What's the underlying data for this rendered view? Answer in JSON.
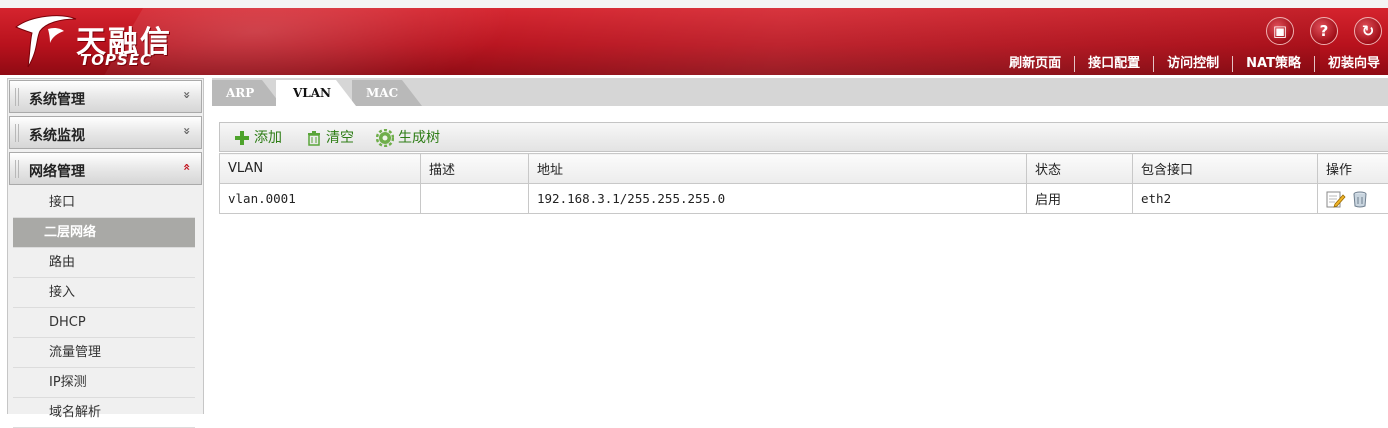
{
  "brand": {
    "name_cn": "天融信",
    "name_en": "TOPSEC"
  },
  "header_icons": [
    {
      "icon": "save-icon",
      "glyph": "▣"
    },
    {
      "icon": "help-icon",
      "glyph": "?"
    },
    {
      "icon": "logout-icon",
      "glyph": "↻"
    }
  ],
  "nav": [
    "刷新页面",
    "接口配置",
    "访问控制",
    "NAT策略",
    "初装向导"
  ],
  "sidebar": {
    "sections": [
      {
        "label": "系统管理",
        "state": "collapsed",
        "chevron": "»"
      },
      {
        "label": "系统监视",
        "state": "collapsed",
        "chevron": "»"
      },
      {
        "label": "网络管理",
        "state": "expanded",
        "chevron": "«"
      }
    ],
    "items": [
      "接口",
      "二层网络",
      "路由",
      "接入",
      "DHCP",
      "流量管理",
      "IP探测",
      "域名解析"
    ],
    "active_item": "二层网络"
  },
  "tabs": [
    {
      "label": "ARP",
      "active": false
    },
    {
      "label": "VLAN",
      "active": true
    },
    {
      "label": "MAC",
      "active": false
    }
  ],
  "toolbar": {
    "add": "添加",
    "clear": "清空",
    "generate_tree": "生成树"
  },
  "table": {
    "columns": [
      "VLAN",
      "描述",
      "地址",
      "状态",
      "包含接口",
      "操作"
    ],
    "rows": [
      {
        "vlan": "vlan.0001",
        "desc": "",
        "address": "192.168.3.1/255.255.255.0",
        "status": "启用",
        "interfaces": "eth2"
      }
    ]
  },
  "colors": {
    "header_red": "#b8121d",
    "toolbar_green": "#2e7d16",
    "active_item_bg": "#a9a9a6"
  }
}
